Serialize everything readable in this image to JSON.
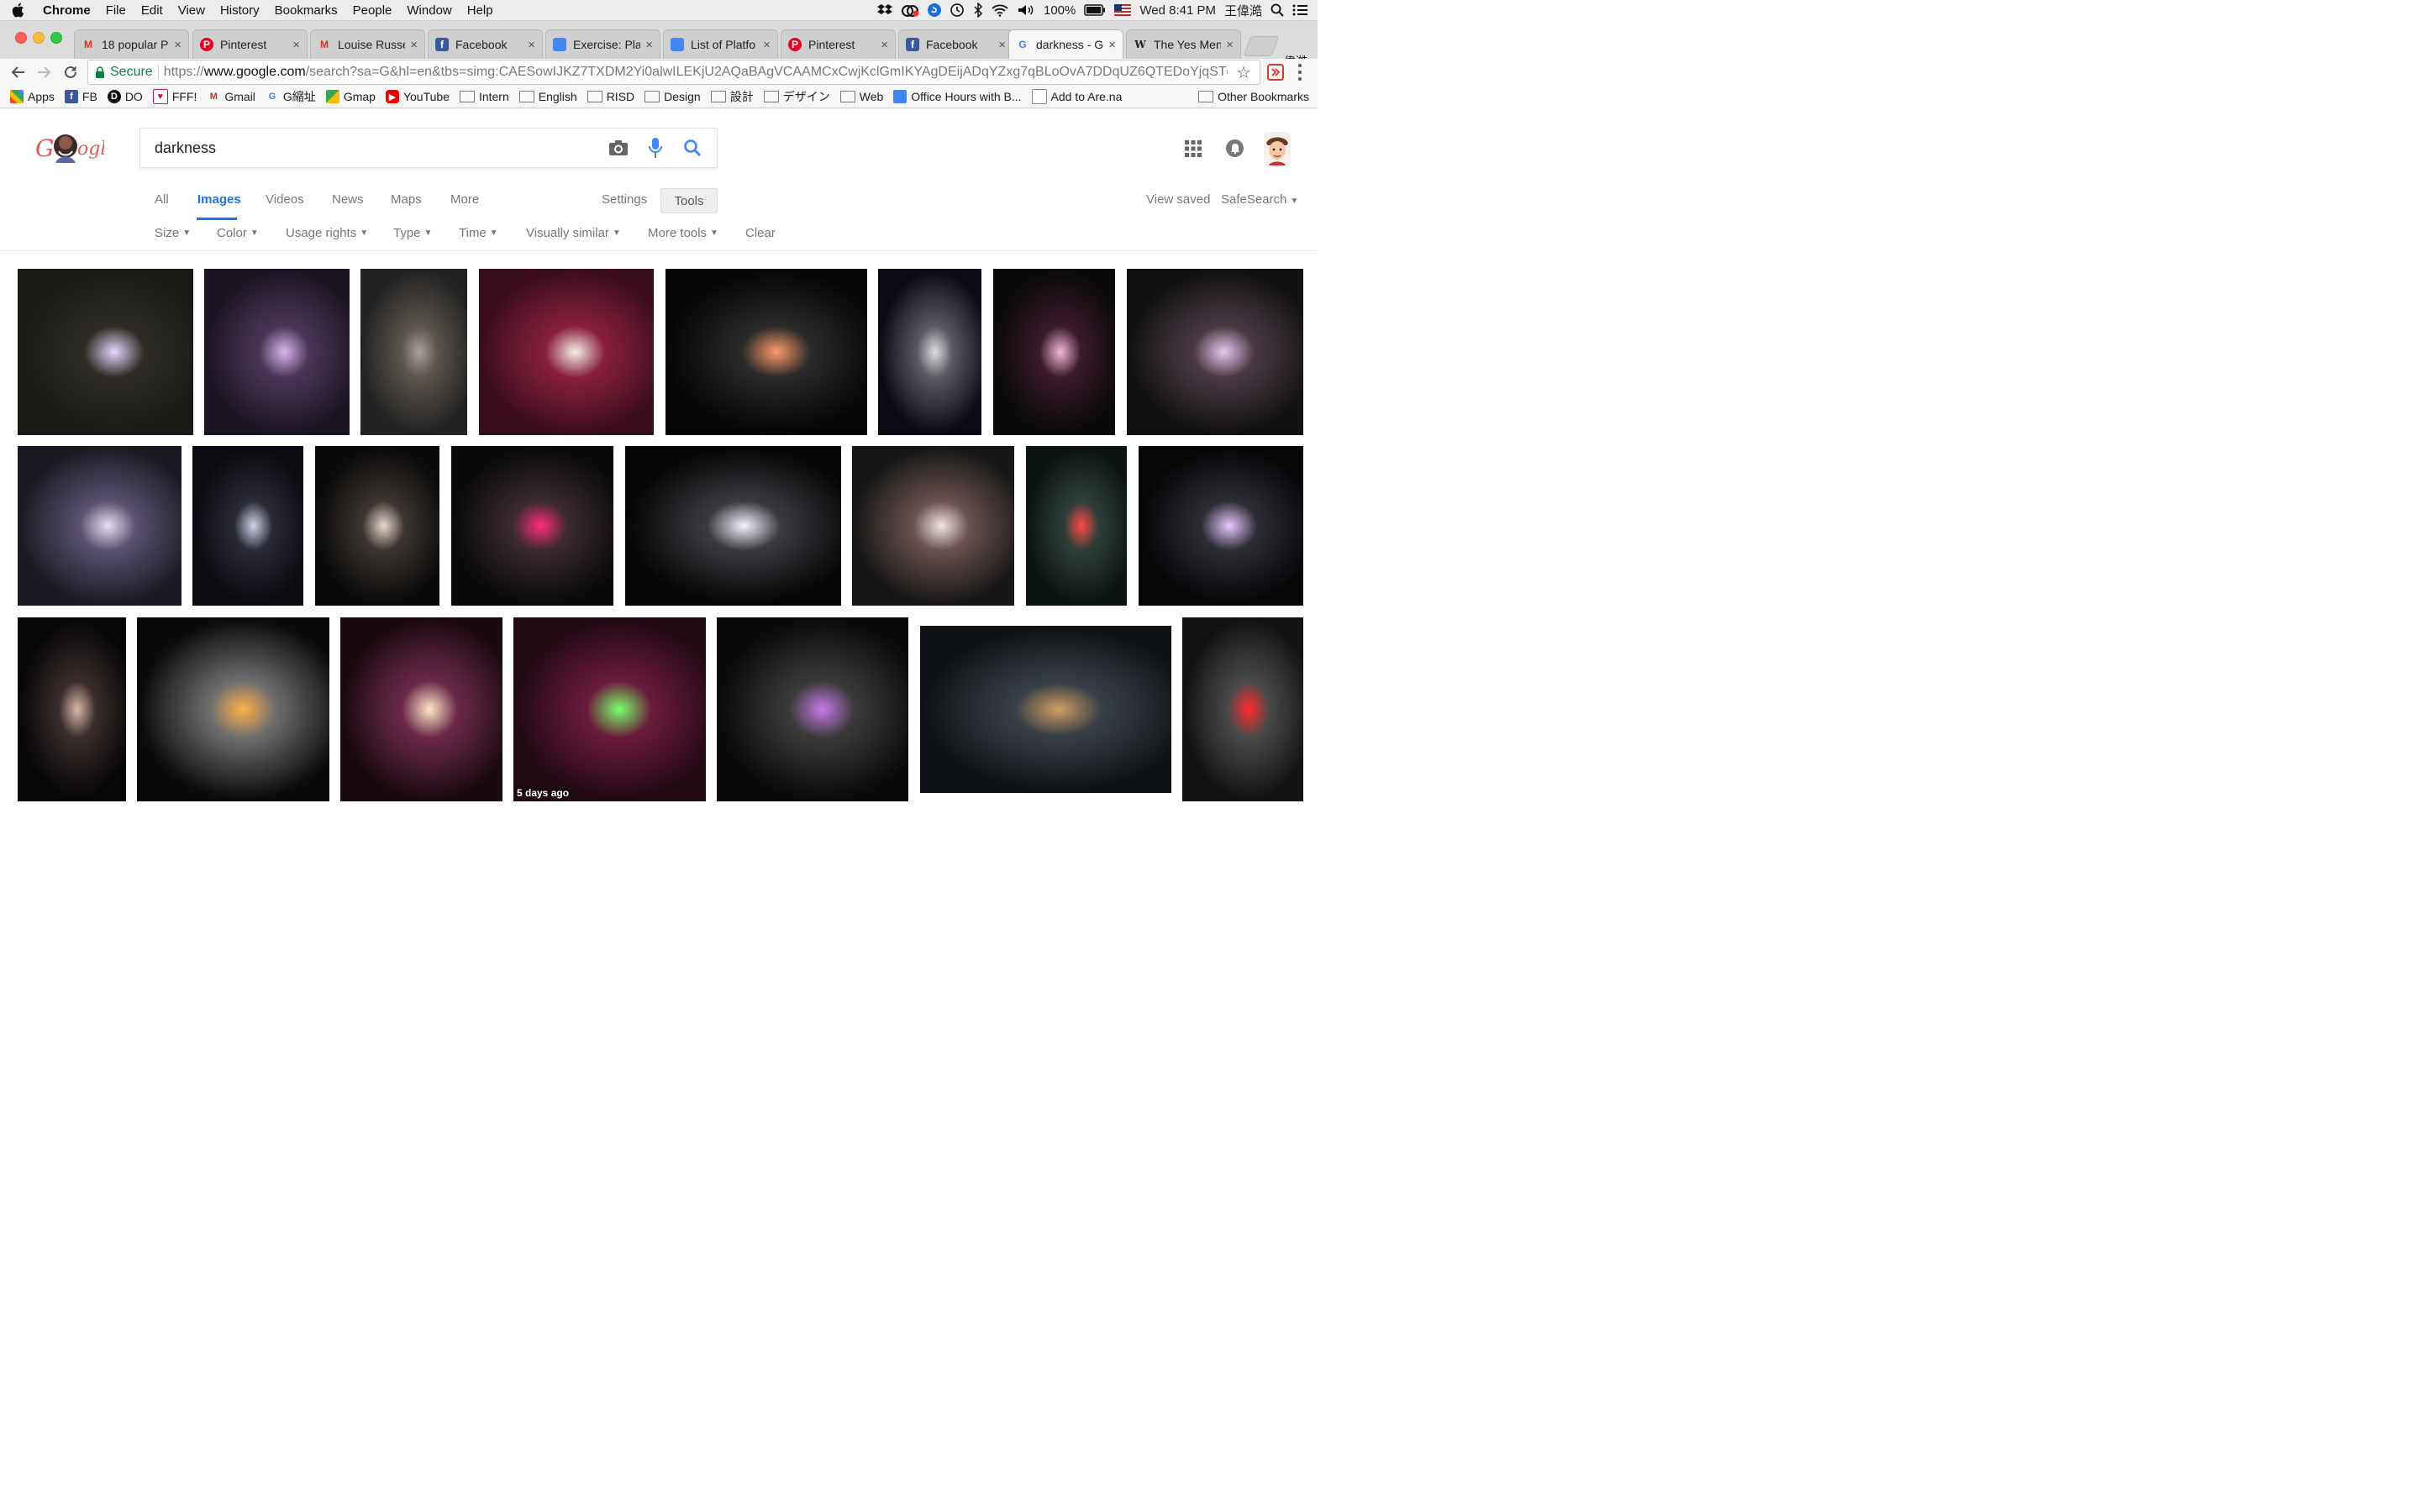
{
  "menubar": {
    "app_name": "Chrome",
    "items": [
      "File",
      "Edit",
      "View",
      "History",
      "Bookmarks",
      "People",
      "Window",
      "Help"
    ],
    "battery": "100%",
    "datetime": "Wed 8:41 PM",
    "user": "王偉澔"
  },
  "tabs": [
    {
      "title": "18 popular P",
      "icon": "gmail-icon"
    },
    {
      "title": "Pinterest",
      "icon": "pinterest-icon"
    },
    {
      "title": "Louise Russe",
      "icon": "gmail-icon"
    },
    {
      "title": "Facebook",
      "icon": "facebook-icon"
    },
    {
      "title": "Exercise: Pla",
      "icon": "docs-icon"
    },
    {
      "title": "List of Platfo",
      "icon": "docs-icon"
    },
    {
      "title": "Pinterest",
      "icon": "pinterest-icon"
    },
    {
      "title": "Facebook",
      "icon": "facebook-icon"
    },
    {
      "title": "darkness - G",
      "icon": "google-icon"
    },
    {
      "title": "The Yes Men",
      "icon": "wikipedia-icon"
    }
  ],
  "profile_name": "偉澔",
  "omnibox": {
    "secure_label": "Secure",
    "url_prefix": "https://",
    "url_host": "www.google.com",
    "url_rest": "/search?sa=G&hl=en&tbs=simg:CAESowIJKZ7TXDM2Yi0alwILEKjU2AQaBAgVCAAMCxCwjKclGmIKYAgDEijADqYZxg7qBLoOvA7DDqUZ6QTEDoYjqSTqLM..."
  },
  "bookmarks": [
    {
      "label": "Apps",
      "icon": "apps-icon"
    },
    {
      "label": "FB",
      "icon": "facebook-icon"
    },
    {
      "label": "DO",
      "icon": "do-icon"
    },
    {
      "label": "FFF!",
      "icon": "heart-icon"
    },
    {
      "label": "Gmail",
      "icon": "gmail-icon"
    },
    {
      "label": "G縮址",
      "icon": "google-icon"
    },
    {
      "label": "Gmap",
      "icon": "maps-icon"
    },
    {
      "label": "YouTube",
      "icon": "youtube-icon"
    },
    {
      "label": "Intern",
      "icon": "folder-icon"
    },
    {
      "label": "English",
      "icon": "folder-icon"
    },
    {
      "label": "RISD",
      "icon": "folder-icon"
    },
    {
      "label": "Design",
      "icon": "folder-icon"
    },
    {
      "label": "設計",
      "icon": "folder-icon"
    },
    {
      "label": "デザイン",
      "icon": "folder-icon"
    },
    {
      "label": "Web",
      "icon": "folder-icon"
    },
    {
      "label": "Office Hours with B...",
      "icon": "docs-icon"
    },
    {
      "label": "Add to Are.na",
      "icon": "page-icon"
    }
  ],
  "other_bookmarks": "Other Bookmarks",
  "search": {
    "query": "darkness"
  },
  "nav_tabs": [
    "All",
    "Images",
    "Videos",
    "News",
    "Maps",
    "More"
  ],
  "settings_label": "Settings",
  "tools_label": "Tools",
  "view_saved": "View saved",
  "safesearch": "SafeSearch",
  "filters": [
    "Size",
    "Color",
    "Usage rights",
    "Type",
    "Time",
    "Visually similar",
    "More tools"
  ],
  "clear_label": "Clear",
  "results": [
    {
      "desc": "glowing cubes in hands",
      "colors": [
        "#1a1a16",
        "#2d2b24",
        "#e8d8ff"
      ]
    },
    {
      "desc": "purple dragon creature",
      "colors": [
        "#1c1422",
        "#4a3656",
        "#d9b6ee"
      ]
    },
    {
      "desc": "shoe on stair",
      "colors": [
        "#222",
        "#5c554d",
        "#a8a09a"
      ]
    },
    {
      "desc": "glowing cube red coat",
      "colors": [
        "#3a0d1c",
        "#8a1f3e",
        "#f4f0e8"
      ]
    },
    {
      "desc": "glowing book",
      "colors": [
        "#050505",
        "#2a2a2a",
        "#ff9a6a"
      ]
    },
    {
      "desc": "pale hand",
      "colors": [
        "#0a0a12",
        "#5a5a64",
        "#e0dde0"
      ]
    },
    {
      "desc": "pink balloons",
      "colors": [
        "#0a0a0a",
        "#3a1a2a",
        "#f2b8d8"
      ]
    },
    {
      "desc": "glowing orb hand",
      "colors": [
        "#111",
        "#4a3a44",
        "#e8c8f0"
      ]
    },
    {
      "desc": "hello kitty lamp",
      "colors": [
        "#1a1a22",
        "#5a5270",
        "#e6e0f0"
      ]
    },
    {
      "desc": "smoke hand",
      "colors": [
        "#0a0a10",
        "#2a2a36",
        "#cfd4e8"
      ]
    },
    {
      "desc": "hand red nails",
      "colors": [
        "#0a0a0a",
        "#3c3430",
        "#e8d6cc"
      ]
    },
    {
      "desc": "pink armband",
      "colors": [
        "#0a0a0a",
        "#3a2a30",
        "#ff2e7a"
      ]
    },
    {
      "desc": "flashlight face",
      "colors": [
        "#050505",
        "#3a3a40",
        "#f4f4ff"
      ]
    },
    {
      "desc": "ring with stone",
      "colors": [
        "#161616",
        "#6a5250",
        "#f2e6e0"
      ]
    },
    {
      "desc": "red ball hand",
      "colors": [
        "#0c1412",
        "#2e3e38",
        "#ff4a4a"
      ]
    },
    {
      "desc": "magician",
      "colors": [
        "#060608",
        "#2c2c34",
        "#e8c8ff"
      ]
    },
    {
      "desc": "woman reclined",
      "colors": [
        "#060606",
        "#3a2c2c",
        "#d8b8a8"
      ]
    },
    {
      "desc": "husky plush",
      "colors": [
        "#0a0a0a",
        "#6e6e6e",
        "#ffb04a"
      ]
    },
    {
      "desc": "chakras",
      "colors": [
        "#1a0a10",
        "#6a2a4a",
        "#ffe8c8"
      ]
    },
    {
      "desc": "laser pointer tablet",
      "colors": [
        "#200a14",
        "#6a1a3a",
        "#7aff6a"
      ],
      "badge": "5 days ago"
    },
    {
      "desc": "purple device",
      "colors": [
        "#0a0a0a",
        "#3a3a3a",
        "#c87ae8"
      ]
    },
    {
      "desc": "writing journal",
      "colors": [
        "#0e1216",
        "#3a4048",
        "#d0a060"
      ]
    },
    {
      "desc": "red light hand",
      "colors": [
        "#121212",
        "#4a4a4a",
        "#ff2a2a"
      ]
    }
  ]
}
